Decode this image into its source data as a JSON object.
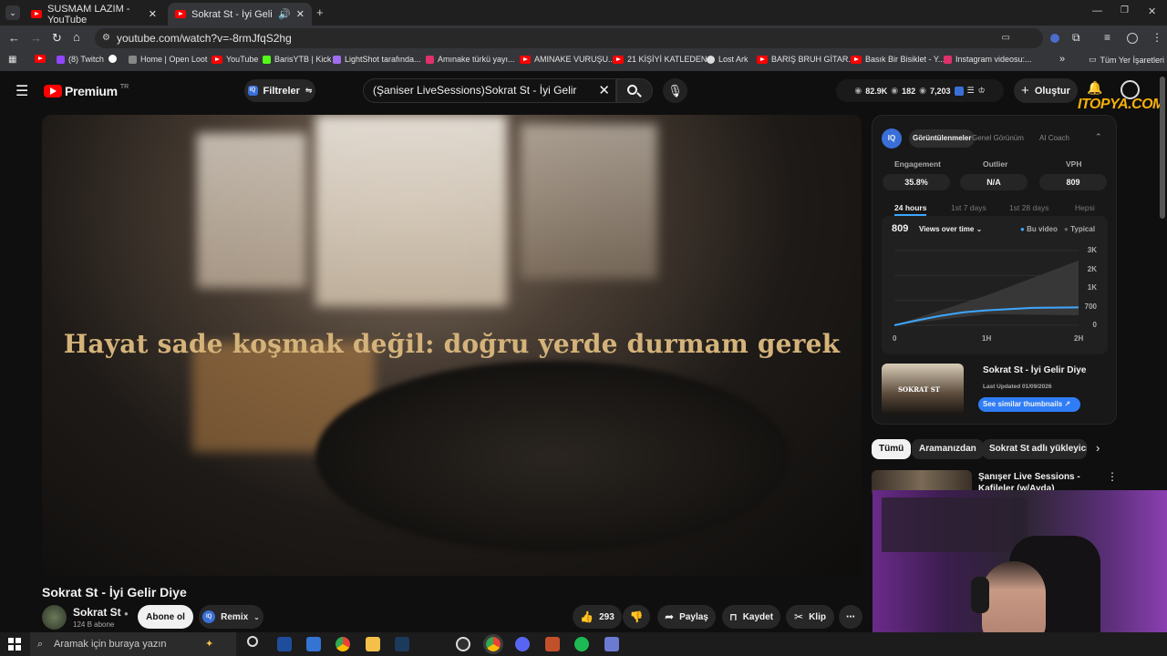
{
  "tabs": [
    {
      "title": "SUSMAM LAZIM - YouTube",
      "active": false
    },
    {
      "title": "Sokrat St - İyi Gelir Diye - Y",
      "active": true
    }
  ],
  "url": "youtube.com/watch?v=-8rmJfqS2hg",
  "bookmarks": [
    "(8) Twitch",
    "Home | Open Loot",
    "YouTube",
    "BarisYTB | Kick",
    "LightShot tarafında...",
    "Amınake türkü yayı...",
    "AMINAKE VURUŞU...",
    "21 KİŞİYİ KATLEDEN...",
    "Lost Ark",
    "BARIŞ BRUH GİTAR...",
    "Basık Bir Bisiklet - Y...",
    "Instagram videosu:...",
    "Tüm Yer İşaretleri"
  ],
  "yt": {
    "logo": "Premium",
    "logo_sup": "TR",
    "filters_label": "Filtreler",
    "search_value": "(Şaniser LiveSessions)Sokrat St - İyi Gelir",
    "header_stats": [
      "82.9K",
      "182",
      "7,203"
    ],
    "create_label": "Oluştur",
    "watermark": "ITOPYA.COM"
  },
  "video": {
    "lyric": "Hayat sade koşmak değil: doğru yerde durmam gerek",
    "title": "Sokrat St - İyi Gelir Diye",
    "channel": "Sokrat St",
    "subs": "124 B abone",
    "subscribe": "Abone ol",
    "remix": "Remix",
    "likes": "293",
    "share": "Paylaş",
    "save": "Kaydet",
    "clip": "Klip"
  },
  "panel": {
    "tabs": [
      "Görüntülenmeler",
      "Genel Görünüm",
      "AI Coach"
    ],
    "stats": [
      {
        "label": "Engagement",
        "value": "35.8%"
      },
      {
        "label": "Outlier",
        "value": "N/A"
      },
      {
        "label": "VPH",
        "value": "809"
      }
    ],
    "ranges": [
      "24 hours",
      "1st 7 days",
      "1st 28 days",
      "Hepsi"
    ],
    "chart_value": "809",
    "chart_mode": "Views over time",
    "legend_this": "Bu video",
    "legend_typical": "Typical",
    "thumb_title": "Sokrat St - İyi Gelir Diye",
    "thumb_updated": "Last Updated 01/09/2026",
    "thumb_caption": "SOKRAT ST",
    "similar_btn": "See similar thumbnails"
  },
  "chart_data": {
    "type": "line",
    "x_ticks": [
      "0",
      "1H",
      "2H"
    ],
    "y_ticks": [
      "3K",
      "2K",
      "1K",
      "700",
      "0"
    ],
    "series": [
      {
        "name": "Bu video",
        "x": [
          0,
          0.25,
          0.5,
          0.75,
          1.0,
          1.5,
          2.0
        ],
        "y": [
          0,
          200,
          380,
          520,
          600,
          700,
          720
        ],
        "color": "#3ea6ff"
      },
      {
        "name": "Typical",
        "x": [
          0,
          1.0,
          2.0
        ],
        "y": [
          0,
          1200,
          2600
        ],
        "color": "#666666"
      }
    ]
  },
  "chips": [
    "Tümü",
    "Aramanızdan",
    "Sokrat St adlı yükleyicid"
  ],
  "related": [
    {
      "title": "Şanışer Live Sessions - Kafileler (w/Ayda)"
    }
  ],
  "taskbar": {
    "search_placeholder": "Aramak için buraya yazın"
  },
  "colors": {
    "accent": "#3ea6ff",
    "lyric": "#d4b37a",
    "youtube_red": "#ff0000"
  }
}
